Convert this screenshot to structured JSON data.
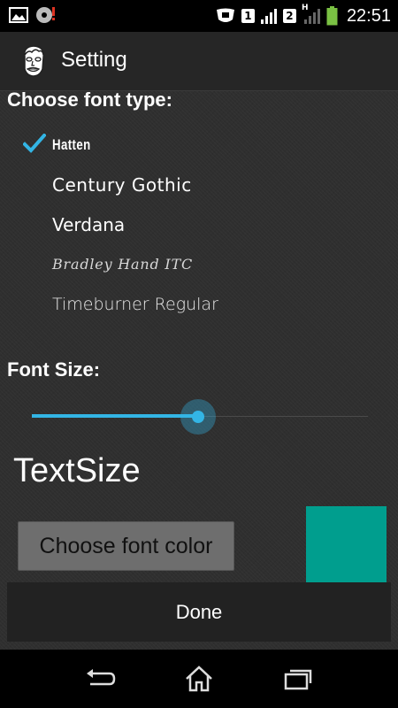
{
  "status_bar": {
    "time": "22:51",
    "sim1": "1",
    "sim2": "2",
    "network_type": "H",
    "icons": [
      "image-notification-icon",
      "cd-icon",
      "shield-icon",
      "signal-icon",
      "battery-icon"
    ]
  },
  "action_bar": {
    "title": "Setting",
    "icon": "app-face-icon"
  },
  "font_type": {
    "heading": "Choose font type:",
    "options": [
      {
        "label": "Hatten",
        "selected": true
      },
      {
        "label": "Century Gothic",
        "selected": false
      },
      {
        "label": "Verdana",
        "selected": false
      },
      {
        "label": "Bradley Hand ITC",
        "selected": false
      },
      {
        "label": "Timeburner Regular",
        "selected": false
      }
    ]
  },
  "font_size": {
    "heading": "Font Size:",
    "slider_value_fraction": 0.495,
    "preview_text": "TextSize"
  },
  "font_color": {
    "button_label": "Choose font color",
    "swatch_color": "#009e8e"
  },
  "done_label": "Done",
  "colors": {
    "accent": "#33b5e5",
    "actionbar_bg": "#262626",
    "content_bg": "#2f2f2f"
  },
  "nav_bar": {
    "icons": [
      "back-icon",
      "home-icon",
      "recents-icon"
    ]
  }
}
